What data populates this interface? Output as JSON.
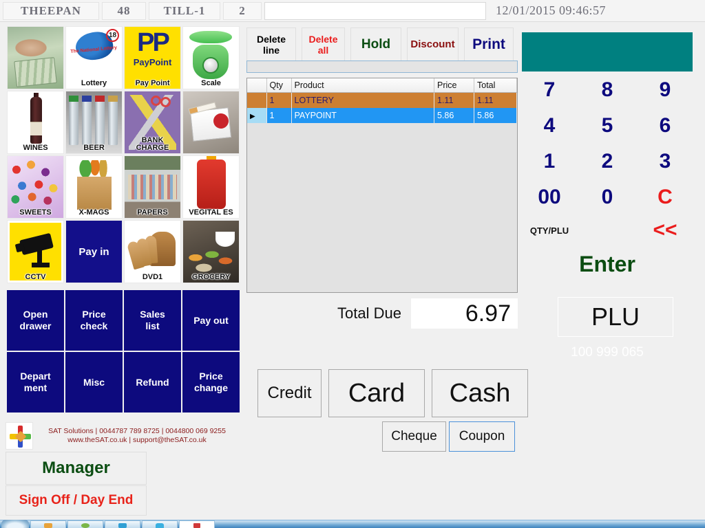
{
  "header": {
    "operator": "THEEPAN",
    "operator_number": "48",
    "till": "TILL-1",
    "transaction": "2",
    "entry_value": "",
    "datetime": "12/01/2015 09:46:57"
  },
  "tiles": [
    {
      "label": "",
      "icon": "cash-image",
      "art": "art-cash"
    },
    {
      "label": "Lottery",
      "icon": "national-lottery-logo",
      "art": "art-lottery",
      "arc_text": "The National Lottery",
      "age_badge": "18"
    },
    {
      "label": "Pay Point",
      "icon": "paypoint-logo",
      "art": "art-paypoint",
      "logo_mark": "PP",
      "logo_word": "PayPoint"
    },
    {
      "label": "Scale",
      "icon": "weighing-scale-image",
      "art": "art-scale"
    },
    {
      "label": "WINES",
      "icon": "wine-bottle-image",
      "art": "art-wine"
    },
    {
      "label": "BEER",
      "icon": "beer-bottles-image",
      "art": "art-beer"
    },
    {
      "label": "BANK CHARGE",
      "icon": "bank-charge-image",
      "art": "art-bank"
    },
    {
      "label": "",
      "icon": "cigarettes-image",
      "art": "art-cigs"
    },
    {
      "label": "SWEETS",
      "icon": "sweets-image",
      "art": "art-sweets"
    },
    {
      "label": "X-MAGS",
      "icon": "grocery-bag-image",
      "art": "art-xmags"
    },
    {
      "label": "PAPERS",
      "icon": "store-aisle-image",
      "art": "art-papers"
    },
    {
      "label": "VEGITAL ES",
      "icon": "lucozade-bottle-image",
      "art": "art-vegi"
    },
    {
      "label": "CCTV",
      "icon": "cctv-camera-icon",
      "art": "art-cctv"
    },
    {
      "label": "",
      "icon": "pay-in-label",
      "art": "art-payin",
      "tile_text": "Pay in"
    },
    {
      "label": "DVD1",
      "icon": "bread-loaf-image",
      "art": "art-dvd1"
    },
    {
      "label": "GROCERY",
      "icon": "catering-food-image",
      "art": "art-grocery"
    }
  ],
  "functions": [
    {
      "label": "Open\ndrawer"
    },
    {
      "label": "Price\ncheck"
    },
    {
      "label": "Sales\nlist"
    },
    {
      "label": "Pay out"
    },
    {
      "label": "Depart\nment"
    },
    {
      "label": "Misc"
    },
    {
      "label": "Refund"
    },
    {
      "label": "Price\nchange"
    }
  ],
  "toolbar": [
    {
      "label": "Delete\nline",
      "id": "tb-deleteline"
    },
    {
      "label": "Delete\nall",
      "id": "tb-deleteall"
    },
    {
      "label": "Hold",
      "id": "tb-hold"
    },
    {
      "label": "Discount",
      "id": "tb-discount"
    },
    {
      "label": "Print",
      "id": "tb-print"
    }
  ],
  "grid": {
    "columns": [
      "",
      "Qty",
      "Product",
      "Price",
      "Total"
    ],
    "rows": [
      {
        "selected": false,
        "qty": "1",
        "product": "LOTTERY",
        "price": "1.11",
        "total": "1.11",
        "style": "orange"
      },
      {
        "selected": true,
        "qty": "1",
        "product": "PAYPOINT",
        "price": "5.86",
        "total": "5.86",
        "style": "blue"
      }
    ],
    "selector_glyph": "▶"
  },
  "total": {
    "label": "Total Due",
    "value": "6.97"
  },
  "payment": {
    "credit": "Credit",
    "card": "Card",
    "cash": "Cash",
    "cheque": "Cheque",
    "coupon": "Coupon"
  },
  "keypad": {
    "keys": [
      {
        "label": "7",
        "style": ""
      },
      {
        "label": "8",
        "style": ""
      },
      {
        "label": "9",
        "style": ""
      },
      {
        "label": "4",
        "style": ""
      },
      {
        "label": "5",
        "style": ""
      },
      {
        "label": "6",
        "style": ""
      },
      {
        "label": "1",
        "style": ""
      },
      {
        "label": "2",
        "style": ""
      },
      {
        "label": "3",
        "style": ""
      },
      {
        "label": "00",
        "style": ""
      },
      {
        "label": "0",
        "style": ""
      },
      {
        "label": "C",
        "style": "red"
      },
      {
        "label": "QTY/PLU",
        "style": "small"
      },
      {
        "label": "",
        "style": "blank"
      },
      {
        "label": "<<",
        "style": "red"
      }
    ],
    "enter": "Enter",
    "plu_button": "PLU",
    "plu_number": "100 999 065",
    "display_value": ""
  },
  "branding": {
    "line1": "SAT Solutions | 0044787 789 8725 | 0044800 069 9255",
    "line2": "www.theSAT.co.uk |  support@theSAT.co.uk"
  },
  "side_buttons": {
    "manager": "Manager",
    "signoff": "Sign Off / Day End"
  },
  "colors": {
    "navy_button": "#0d0a7e",
    "teal_display": "#008080",
    "row_orange": "#cd7f32",
    "row_blue": "#2196f3",
    "red_text": "#ea1c1c",
    "green_text": "#0b4d12"
  }
}
